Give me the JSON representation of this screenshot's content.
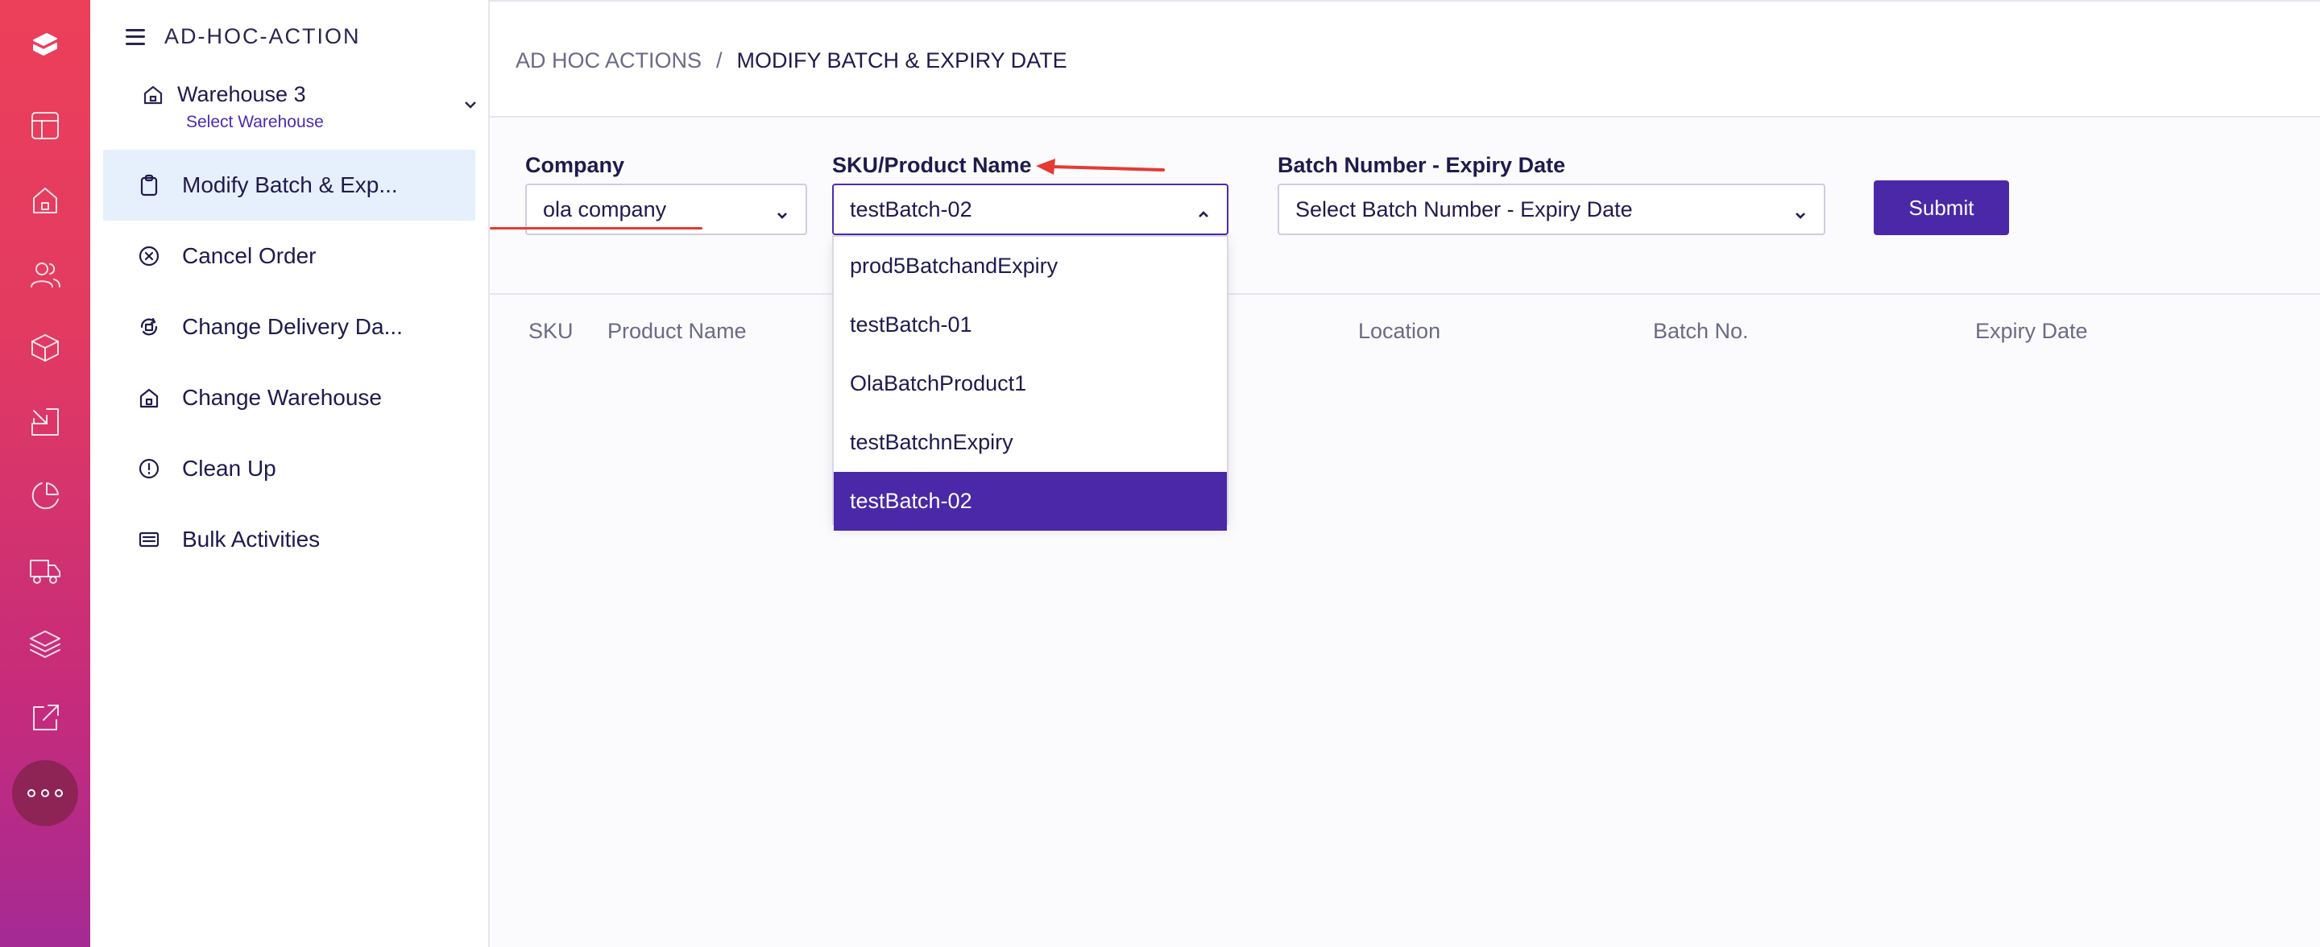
{
  "sidebar": {
    "title": "AD-HOC-ACTION",
    "warehouse": {
      "name": "Warehouse 3",
      "sub": "Select Warehouse"
    },
    "items": [
      {
        "label": "Modify Batch & Exp...",
        "icon": "clipboard-icon",
        "active": true
      },
      {
        "label": "Cancel Order",
        "icon": "cancel-circle-icon"
      },
      {
        "label": "Change Delivery Da...",
        "icon": "calendar-sync-icon"
      },
      {
        "label": "Change Warehouse",
        "icon": "warehouse-icon"
      },
      {
        "label": "Clean Up",
        "icon": "alert-circle-icon"
      },
      {
        "label": "Bulk Activities",
        "icon": "list-card-icon"
      }
    ]
  },
  "breadcrumb": {
    "root": "AD HOC ACTIONS",
    "separator": "/",
    "current": "MODIFY BATCH & EXPIRY DATE"
  },
  "filters": {
    "company": {
      "label": "Company",
      "value": "ola company"
    },
    "sku": {
      "label": "SKU/Product Name",
      "value": "testBatch-02"
    },
    "batch": {
      "label": "Batch Number - Expiry Date",
      "placeholder": "Select Batch Number - Expiry Date"
    },
    "submit": "Submit"
  },
  "sku_options": [
    "prod5BatchandExpiry",
    "testBatch-01",
    "OlaBatchProduct1",
    "testBatchnExpiry",
    "testBatch-02"
  ],
  "table": {
    "columns": [
      "SKU",
      "Product Name",
      "Location",
      "Batch No.",
      "Expiry Date"
    ]
  },
  "colors": {
    "accent": "#4a28a8",
    "rail_top": "#ec3f5a",
    "rail_bottom": "#a52a94",
    "annotation": "#e53a32"
  }
}
